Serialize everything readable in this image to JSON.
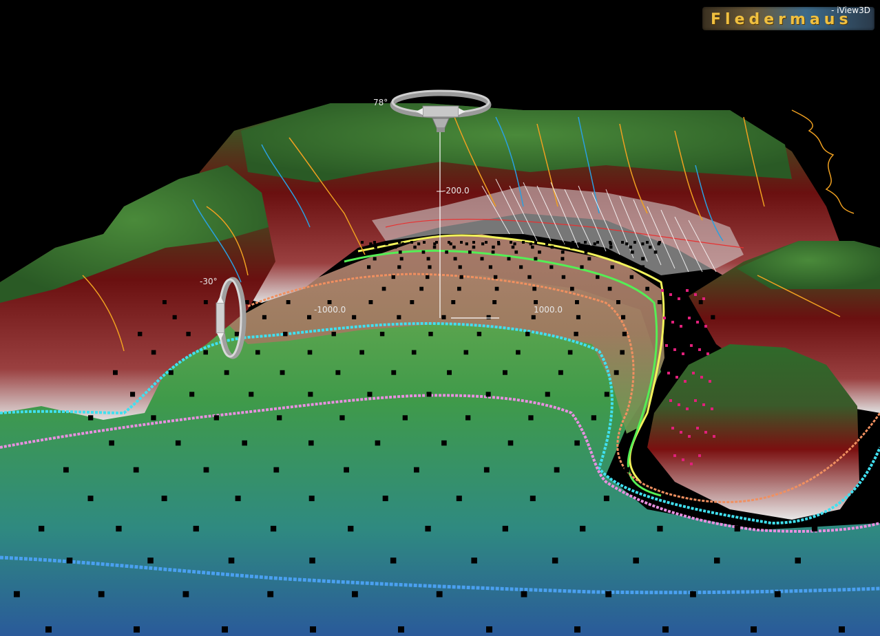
{
  "app": {
    "brand": "Fledermaus",
    "product": "- iView3D"
  },
  "navigation": {
    "pitch_label": "78°",
    "roll_label": "-30°"
  },
  "scale": {
    "vertical_label": "-200.0",
    "left_label": "-1000.0",
    "right_label": "1000.0"
  },
  "colors": {
    "background": "#000000",
    "land_green": "#2f6a2a",
    "cliff_red": "#7a1010",
    "shelf_green": "#3f9a44",
    "deep_blue": "#2a5a9a",
    "contour_yellow": "#f2f25a",
    "contour_green": "#55ee55",
    "contour_orange": "#f09060",
    "contour_cyan": "#40e0f0",
    "contour_pink": "#e890e0",
    "contour_blue": "#4aa0f0",
    "river_orange": "#f0a020",
    "river_blue": "#2aa0e0",
    "sample_points": "#000000"
  }
}
